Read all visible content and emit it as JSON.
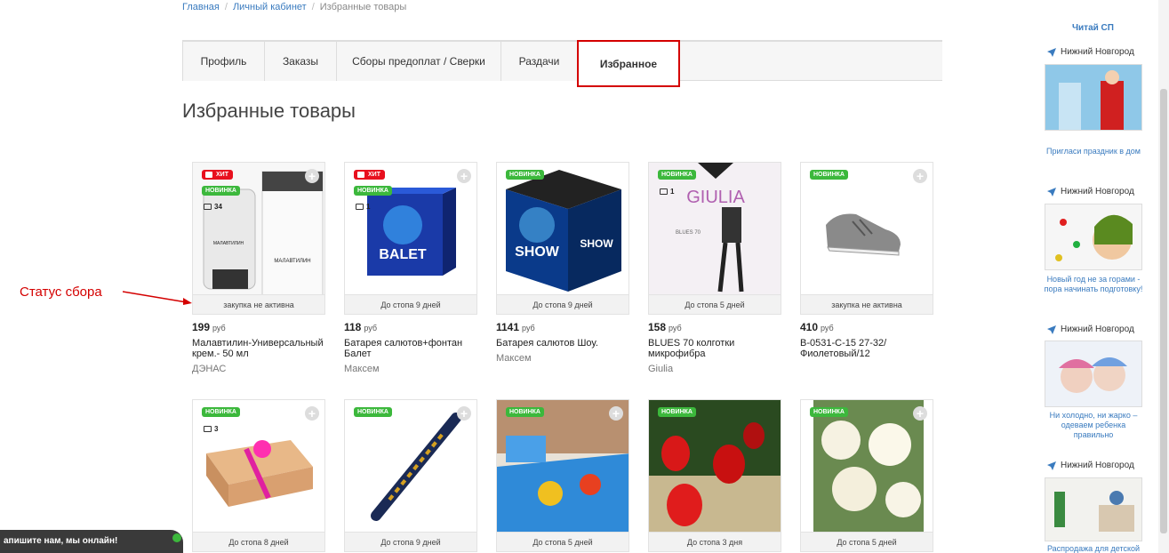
{
  "breadcrumb": {
    "home": "Главная",
    "account": "Личный кабинет",
    "current": "Избранные товары"
  },
  "tabs": [
    {
      "label": "Профиль"
    },
    {
      "label": "Заказы"
    },
    {
      "label": "Сборы предоплат / Сверки"
    },
    {
      "label": "Раздачи"
    },
    {
      "label": "Избранное",
      "active": true
    }
  ],
  "page_title": "Избранные товары",
  "annotation": {
    "label": "Статус сбора",
    "color": "#d40000"
  },
  "badges": {
    "hit": "ХИТ",
    "new": "НОВИНКА"
  },
  "currency": "руб",
  "products_row1": [
    {
      "price": "199",
      "name": "Малавтилин-Универсальный крем.- 50 мл",
      "vendor": "ДЭНАС",
      "status": "закупка не активна",
      "hit": true,
      "new": true,
      "comments": "34"
    },
    {
      "price": "118",
      "name": "Батарея салютов+фонтан Балет",
      "vendor": "Максем",
      "status": "До стопа 9 дней",
      "hit": true,
      "new": true,
      "comments": "1"
    },
    {
      "price": "1141",
      "name": "Батарея салютов Шоу.",
      "vendor": "Максем",
      "status": "До стопа 9 дней",
      "hit": false,
      "new": true,
      "comments": ""
    },
    {
      "price": "158",
      "name": "BLUES 70 колготки микрофибра",
      "vendor": "Giulia",
      "status": "До стопа 5 дней",
      "hit": false,
      "new": true,
      "comments": "1"
    },
    {
      "price": "410",
      "name": "B-0531-C-15 27-32/ Фиолетовый/12",
      "vendor": "",
      "status": "закупка не активна",
      "hit": false,
      "new": true,
      "comments": ""
    }
  ],
  "products_row2": [
    {
      "status": "До стопа 8 дней",
      "new": true,
      "comments": "3"
    },
    {
      "status": "До стопа 9 дней",
      "new": true,
      "comments": ""
    },
    {
      "status": "До стопа 5 дней",
      "new": true,
      "comments": ""
    },
    {
      "status": "До стопа 3 дня",
      "new": true,
      "comments": ""
    },
    {
      "status": "До стопа 5 дней",
      "new": true,
      "comments": ""
    }
  ],
  "image_text": {
    "balet": "BALET",
    "show": "SHOW",
    "giulia": "GIULIA",
    "blues": "BLUES 70",
    "malav": "МАЛАВТИЛИН"
  },
  "sidebar": {
    "title": "Читай СП",
    "ads": [
      {
        "city": "Нижний Новгород",
        "caption": "Пригласи праздник в дом"
      },
      {
        "city": "Нижний Новгород",
        "caption": "Новый год не за горами - пора начинать подготовку!"
      },
      {
        "city": "Нижний Новгород",
        "caption": "Ни холодно, ни жарко – одеваем ребенка правильно"
      },
      {
        "city": "Нижний Новгород",
        "caption": "Распродажа для детской"
      }
    ]
  },
  "chat": {
    "label": "апишите нам, мы онлайн!"
  },
  "colors": {
    "accent": "#d40000",
    "link": "#3a7bbf",
    "new_badge": "#3cb83c",
    "hit_badge": "#e8101e"
  }
}
